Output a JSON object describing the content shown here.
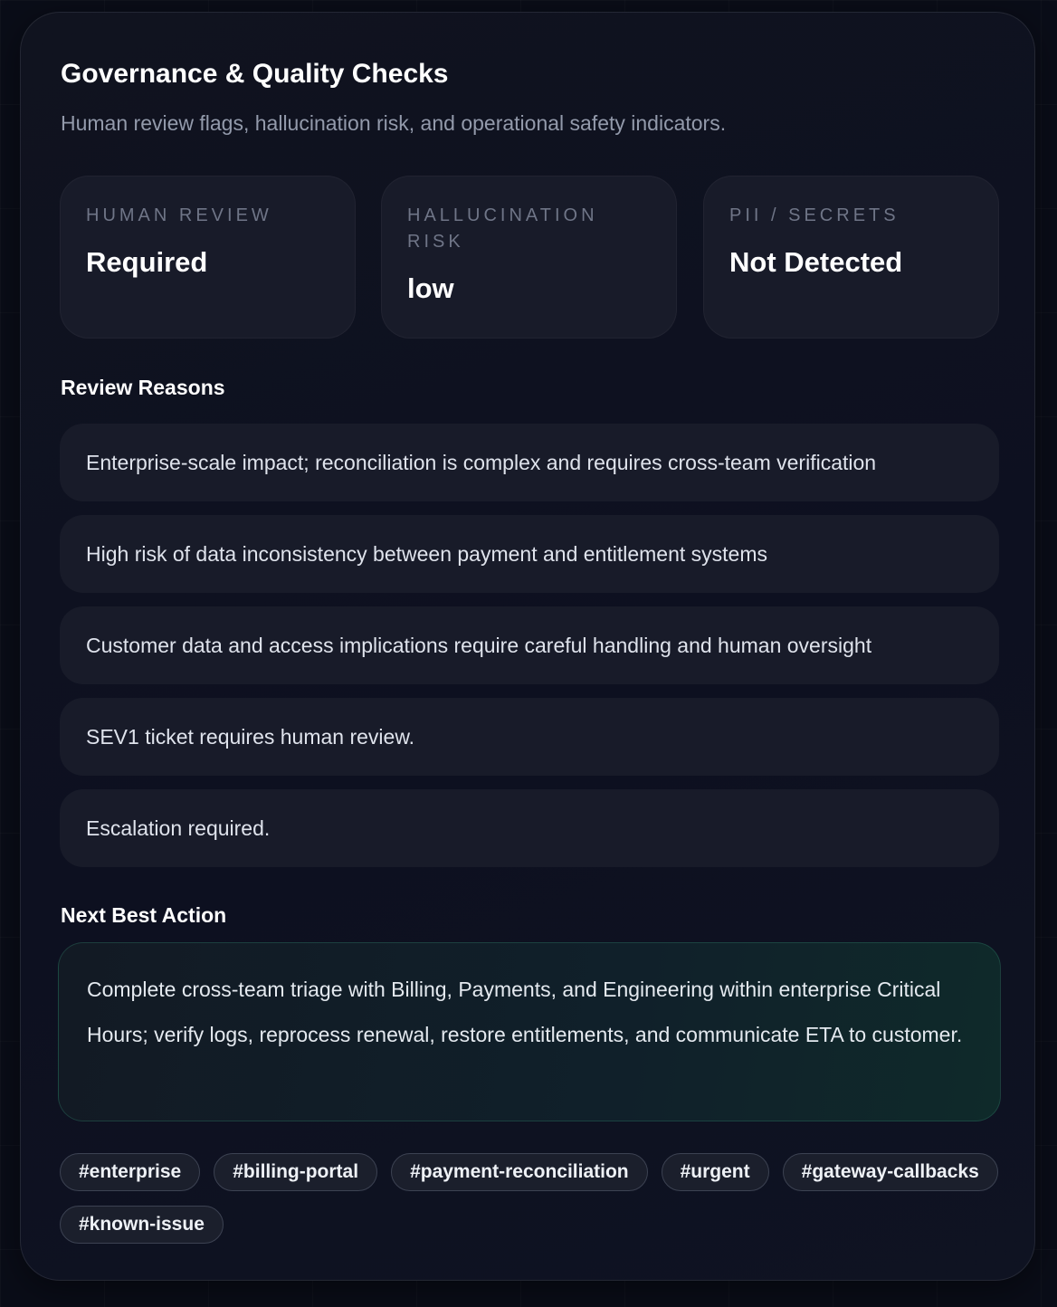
{
  "panel": {
    "title": "Governance & Quality Checks",
    "subtitle": "Human review flags, hallucination risk, and operational safety indicators."
  },
  "stats": [
    {
      "label": "HUMAN REVIEW",
      "value": "Required"
    },
    {
      "label": "HALLUCINATION RISK",
      "value": "low"
    },
    {
      "label": "PII / SECRETS",
      "value": "Not Detected"
    }
  ],
  "review_reasons": {
    "heading": "Review Reasons",
    "items": [
      "Enterprise-scale impact; reconciliation is complex and requires cross-team verification",
      "High risk of data inconsistency between payment and entitlement systems",
      "Customer data and access implications require careful handling and human oversight",
      "SEV1 ticket requires human review.",
      "Escalation required."
    ]
  },
  "next_best_action": {
    "heading": "Next Best Action",
    "text": "Complete cross-team triage with Billing, Payments, and Engineering within enterprise Critical Hours; verify logs, reprocess renewal, restore entitlements, and communicate ETA to customer."
  },
  "tags": [
    "#enterprise",
    "#billing-portal",
    "#payment-reconciliation",
    "#urgent",
    "#gateway-callbacks",
    "#known-issue"
  ]
}
